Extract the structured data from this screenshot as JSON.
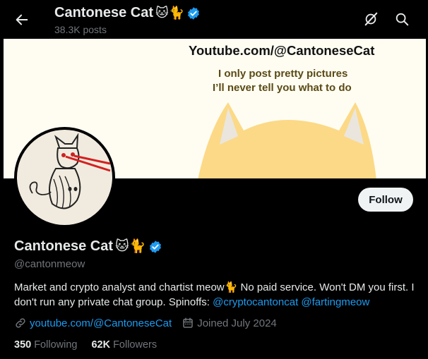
{
  "header": {
    "title": "Cantonese Cat",
    "emojis": "🐱🐈",
    "post_count": "38.3K posts"
  },
  "banner": {
    "url_text": "Youtube.com/@CantoneseCat",
    "line1": "I only post pretty pictures",
    "line2": "I’ll never tell you what to do"
  },
  "profile": {
    "display_name": "Cantonese Cat",
    "emojis": "🐱🐈",
    "handle": "@cantonmeow",
    "follow_label": "Follow",
    "bio_text_1": "Market and crypto analyst and chartist meow",
    "bio_emoji": "🐈",
    "bio_text_2": " No paid service. Won't DM you first. I don't run any private chat group. Spinoffs: ",
    "bio_link_1": "@cryptocantoncat",
    "bio_link_2": "@fartingmeow",
    "website": "youtube.com/@CantoneseCat",
    "joined": "Joined July 2024",
    "following_count": "350",
    "following_label": "Following",
    "followers_count": "62K",
    "followers_label": "Followers"
  },
  "icons": {
    "back": "arrow-left-icon",
    "grok": "grok-slash-icon",
    "search": "search-icon",
    "verified": "verified-badge-icon",
    "link": "link-icon",
    "calendar": "calendar-icon"
  },
  "colors": {
    "accent": "#1d9bf0",
    "muted": "#71767b",
    "banner_bg": "#fffdf2",
    "banner_cat": "#fcd986"
  }
}
